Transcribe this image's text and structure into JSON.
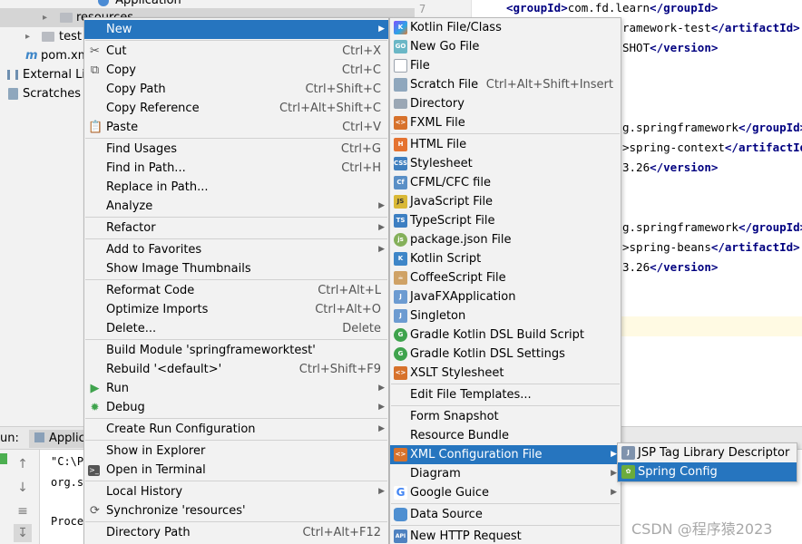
{
  "project_tree": {
    "partial_top_label": "Application",
    "rows": [
      {
        "label": "resources",
        "icon": "folder-icon"
      },
      {
        "label": "test",
        "icon": "folder-icon"
      },
      {
        "label": "pom.xm",
        "icon": "maven-icon"
      },
      {
        "label": "External Lib",
        "icon": "library-icon"
      },
      {
        "label": "Scratches a",
        "icon": "scratches-icon"
      }
    ]
  },
  "editor": {
    "line_number": "7",
    "lines": [
      {
        "open": "<groupId>",
        "text": "com.fd.learn",
        "close": "</groupId>"
      },
      {
        "open": "",
        "text": "ramework-test",
        "close": "</artifactId>"
      },
      {
        "open": "",
        "text": "SHOT",
        "close": "</version>"
      },
      {
        "open": "",
        "text": "g.springframework",
        "close": "</groupId>"
      },
      {
        "open": ">",
        "text": "spring-context",
        "close": "</artifactId>"
      },
      {
        "open": "",
        "text": "3.26",
        "close": "</version>"
      },
      {
        "open": "",
        "text": "g.springframework",
        "close": "</groupId>"
      },
      {
        "open": ">",
        "text": "spring-beans",
        "close": "</artifactId>"
      },
      {
        "open": "",
        "text": "3.26",
        "close": "</version>"
      }
    ]
  },
  "run_panel": {
    "label": "un:",
    "tab": "Applic",
    "console_lines": [
      "\"C:\\P",
      "org.s",
      "Proce"
    ]
  },
  "context_menu": {
    "items": [
      {
        "label": "New",
        "shortcut": "",
        "submenu": true,
        "icon": "",
        "selected": true
      },
      {
        "label": "Cut",
        "shortcut": "Ctrl+X",
        "icon": "scissors-icon"
      },
      {
        "label": "Copy",
        "shortcut": "Ctrl+C",
        "icon": "copy-icon"
      },
      {
        "label": "Copy Path",
        "shortcut": "Ctrl+Shift+C",
        "icon": ""
      },
      {
        "label": "Copy Reference",
        "shortcut": "Ctrl+Alt+Shift+C",
        "icon": ""
      },
      {
        "label": "Paste",
        "shortcut": "Ctrl+V",
        "icon": "paste-icon"
      },
      {
        "label": "Find Usages",
        "shortcut": "Ctrl+G",
        "icon": ""
      },
      {
        "label": "Find in Path...",
        "shortcut": "Ctrl+H",
        "icon": ""
      },
      {
        "label": "Replace in Path...",
        "shortcut": "",
        "icon": ""
      },
      {
        "label": "Analyze",
        "shortcut": "",
        "submenu": true,
        "icon": ""
      },
      {
        "label": "Refactor",
        "shortcut": "",
        "submenu": true,
        "icon": ""
      },
      {
        "label": "Add to Favorites",
        "shortcut": "",
        "submenu": true,
        "icon": ""
      },
      {
        "label": "Show Image Thumbnails",
        "shortcut": "",
        "icon": ""
      },
      {
        "label": "Reformat Code",
        "shortcut": "Ctrl+Alt+L",
        "icon": ""
      },
      {
        "label": "Optimize Imports",
        "shortcut": "Ctrl+Alt+O",
        "icon": ""
      },
      {
        "label": "Delete...",
        "shortcut": "Delete",
        "icon": ""
      },
      {
        "label": "Build Module 'springframeworktest'",
        "shortcut": "",
        "icon": ""
      },
      {
        "label": "Rebuild '<default>'",
        "shortcut": "Ctrl+Shift+F9",
        "icon": ""
      },
      {
        "label": "Run",
        "shortcut": "",
        "submenu": true,
        "icon": "run-icon"
      },
      {
        "label": "Debug",
        "shortcut": "",
        "submenu": true,
        "icon": "debug-icon"
      },
      {
        "label": "Create Run Configuration",
        "shortcut": "",
        "submenu": true,
        "icon": ""
      },
      {
        "label": "Show in Explorer",
        "shortcut": "",
        "icon": ""
      },
      {
        "label": "Open in Terminal",
        "shortcut": "",
        "icon": "terminal-icon"
      },
      {
        "label": "Local History",
        "shortcut": "",
        "submenu": true,
        "icon": ""
      },
      {
        "label": "Synchronize 'resources'",
        "shortcut": "",
        "icon": "sync-icon"
      },
      {
        "label": "Directory Path",
        "shortcut": "Ctrl+Alt+F12",
        "icon": ""
      }
    ]
  },
  "new_submenu": {
    "items": [
      {
        "label": "Kotlin File/Class",
        "shortcut": "",
        "icon": "kotlin-icon"
      },
      {
        "label": "New Go File",
        "shortcut": "",
        "icon": "go-icon"
      },
      {
        "label": "File",
        "shortcut": "",
        "icon": "file-icon"
      },
      {
        "label": "Scratch File",
        "shortcut": "Ctrl+Alt+Shift+Insert",
        "icon": "scratch-icon"
      },
      {
        "label": "Directory",
        "shortcut": "",
        "icon": "folder-icon"
      },
      {
        "label": "FXML File",
        "shortcut": "",
        "icon": "fxml-icon"
      },
      {
        "label": "HTML File",
        "shortcut": "",
        "icon": "html-icon"
      },
      {
        "label": "Stylesheet",
        "shortcut": "",
        "icon": "css-icon"
      },
      {
        "label": "CFML/CFC file",
        "shortcut": "",
        "icon": "cfml-icon"
      },
      {
        "label": "JavaScript File",
        "shortcut": "",
        "icon": "javascript-icon"
      },
      {
        "label": "TypeScript File",
        "shortcut": "",
        "icon": "typescript-icon"
      },
      {
        "label": "package.json File",
        "shortcut": "",
        "icon": "nodejs-icon"
      },
      {
        "label": "Kotlin Script",
        "shortcut": "",
        "icon": "kotlin-script-icon"
      },
      {
        "label": "CoffeeScript File",
        "shortcut": "",
        "icon": "coffeescript-icon"
      },
      {
        "label": "JavaFXApplication",
        "shortcut": "",
        "icon": "javafx-icon"
      },
      {
        "label": "Singleton",
        "shortcut": "",
        "icon": "singleton-icon"
      },
      {
        "label": "Gradle Kotlin DSL Build Script",
        "shortcut": "",
        "icon": "gradle-icon"
      },
      {
        "label": "Gradle Kotlin DSL Settings",
        "shortcut": "",
        "icon": "gradle-icon"
      },
      {
        "label": "XSLT Stylesheet",
        "shortcut": "",
        "icon": "xslt-icon"
      },
      {
        "label": "Edit File Templates...",
        "shortcut": "",
        "icon": ""
      },
      {
        "label": "Form Snapshot",
        "shortcut": "",
        "icon": ""
      },
      {
        "label": "Resource Bundle",
        "shortcut": "",
        "icon": ""
      },
      {
        "label": "XML Configuration File",
        "shortcut": "",
        "icon": "xml-icon",
        "submenu": true,
        "selected": true
      },
      {
        "label": "Diagram",
        "shortcut": "",
        "icon": "",
        "submenu": true
      },
      {
        "label": "Google Guice",
        "shortcut": "",
        "icon": "google-icon",
        "submenu": true
      },
      {
        "label": "Data Source",
        "shortcut": "",
        "icon": "database-icon"
      },
      {
        "label": "New HTTP Request",
        "shortcut": "",
        "icon": "api-icon"
      }
    ]
  },
  "xml_submenu": {
    "items": [
      {
        "label": "JSP Tag Library Descriptor",
        "icon": "jsp-icon"
      },
      {
        "label": "Spring Config",
        "icon": "spring-icon",
        "selected": true
      }
    ]
  },
  "watermark": "CSDN @程序猿2023",
  "colors": {
    "selection": "#2675bf",
    "menu_bg": "#f2f2f2",
    "xml_tag": "#000080"
  }
}
